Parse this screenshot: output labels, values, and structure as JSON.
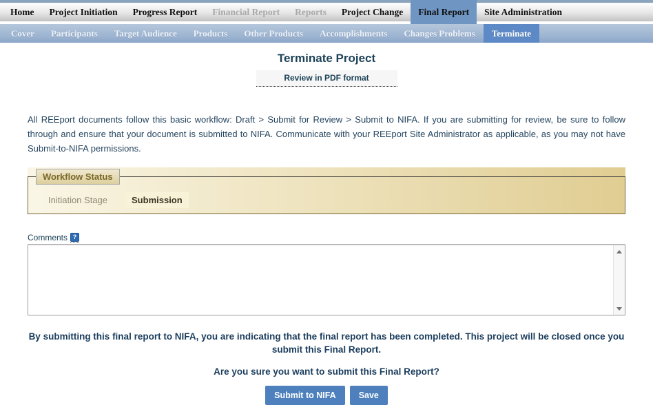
{
  "topbar": {
    "items": [
      {
        "label": "Home",
        "state": "normal"
      },
      {
        "label": "Project Initiation",
        "state": "normal"
      },
      {
        "label": "Progress Report",
        "state": "normal"
      },
      {
        "label": "Financial Report",
        "state": "disabled"
      },
      {
        "label": "Reports",
        "state": "disabled"
      },
      {
        "label": "Project Change",
        "state": "normal"
      },
      {
        "label": "Final Report",
        "state": "selected"
      },
      {
        "label": "Site Administration",
        "state": "normal"
      }
    ]
  },
  "subnav": {
    "items": [
      {
        "label": "Cover",
        "state": "normal"
      },
      {
        "label": "Participants",
        "state": "normal"
      },
      {
        "label": "Target Audience",
        "state": "normal"
      },
      {
        "label": "Products",
        "state": "normal"
      },
      {
        "label": "Other Products",
        "state": "normal"
      },
      {
        "label": "Accomplishments",
        "state": "normal"
      },
      {
        "label": "Changes Problems",
        "state": "normal"
      },
      {
        "label": "Terminate",
        "state": "selected"
      }
    ]
  },
  "page": {
    "title": "Terminate Project",
    "review_button_label": "Review in PDF format",
    "workflow_note": "All REEport documents follow this basic workflow:  Draft > Submit for Review > Submit to NIFA.  If you are submitting for review, be sure to follow through and ensure that your document is submitted to NIFA.  Communicate with your REEport Site Administrator as applicable, as you may not have Submit-to-NIFA permissions."
  },
  "workflow_status": {
    "legend": "Workflow Status",
    "stages": [
      {
        "label": "Initiation Stage",
        "state": "inactive"
      },
      {
        "label": "Submission",
        "state": "active"
      }
    ]
  },
  "comments": {
    "label": "Comments",
    "help_icon": "?",
    "value": "",
    "placeholder": ""
  },
  "confirmation": {
    "statement": "By submitting this final report to NIFA, you are indicating that the final report has been completed. This project will be closed once you submit this Final Report.",
    "question": "Are you sure you want to submit this Final Report?"
  },
  "actions": {
    "submit_label": "Submit to NIFA",
    "save_label": "Save"
  },
  "colors": {
    "top_rule_blue": "#8ba4bd",
    "nav_selected_blue": "#6f95c3",
    "subnav_bg_blue": "#9bb3d1",
    "subnav_selected_blue": "#5d8ac6",
    "workflow_box_tan_start": "#faf6e6",
    "workflow_box_tan_end": "#e0cd92",
    "workflow_legend_text": "#7b682a",
    "title_navy": "#1c4257",
    "body_navy": "#25455f",
    "help_icon_blue": "#2e6cb5",
    "button_blue": "#4d80bc"
  }
}
